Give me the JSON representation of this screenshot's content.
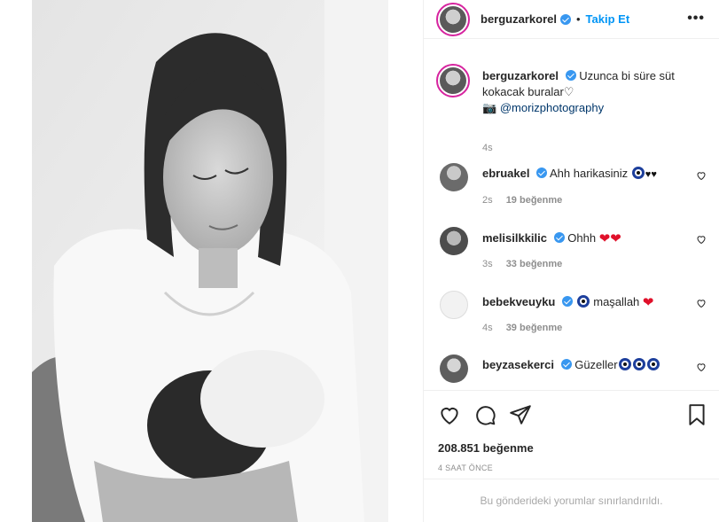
{
  "post": {
    "username": "berguzarkorel",
    "follow_label": "Takip Et",
    "more_label": "•••"
  },
  "caption": {
    "username": "berguzarkorel",
    "text_line1": "Uzunca bi süre süt",
    "text_line2": "kokacak buralar",
    "camera_emoji": "📷",
    "mention": "@morizphotography",
    "time": "4s"
  },
  "comments": [
    {
      "username": "ebruakel",
      "text": "Ahh harikasiniz",
      "time": "2s",
      "likes": "19 beğenme"
    },
    {
      "username": "melisilkkilic",
      "text": "Ohhh",
      "time": "3s",
      "likes": "33 beğenme"
    },
    {
      "username": "bebekveuyku",
      "text": "maşallah",
      "time": "4s",
      "likes": "39 beğenme"
    },
    {
      "username": "beyzasekerci",
      "text": "Güzeller",
      "time": "",
      "likes": ""
    }
  ],
  "likes_count": "208.851 beğenme",
  "post_time": "4 SAAT ÖNCE",
  "restricted_notice": "Bu gönderideki yorumlar sınırlandırıldı.",
  "icons": [
    "heart-icon",
    "comment-icon",
    "share-icon",
    "bookmark-icon",
    "verified-badge-icon",
    "camera-icon",
    "evil-eye-icon"
  ],
  "colors": {
    "accent": "#0095f6",
    "verified": "#3897f0",
    "muted": "#8e8e8e",
    "heart_red": "#e0102a",
    "evil_eye_blue": "#1d3f9c"
  }
}
